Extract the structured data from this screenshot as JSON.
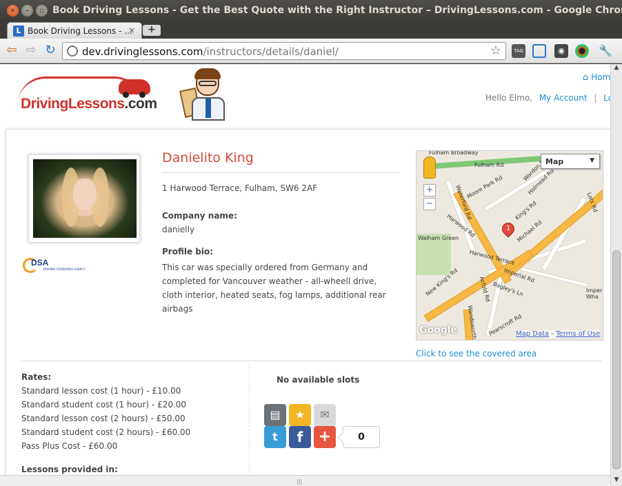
{
  "window": {
    "title": "Book Driving Lessons - Get the Best Quote with the Right Instructor – DrivingLessons.com - Google Chrome"
  },
  "tab": {
    "label": "Book Driving Lessons - …",
    "favicon": "L"
  },
  "toolbar": {
    "url_host": "dev.drivinglessons.com",
    "url_path": "/instructors/details/daniel/",
    "back_icon": "back-arrow-icon",
    "forward_icon": "forward-arrow-icon",
    "reload_icon": "reload-icon",
    "tag_label": "TAG"
  },
  "header": {
    "logo_main": "DrivingLessons",
    "logo_tld": ".com",
    "home_link": "Hom",
    "greeting": "Hello Elmo,",
    "account_link": "My Account",
    "logout_link": "Logo"
  },
  "instructor": {
    "name": "Danielito King",
    "address": "1 Harwood Terrace, Fulham, SW6 2AF",
    "company_label": "Company name:",
    "company_value": "danielly",
    "bio_label": "Profile bio:",
    "bio": "This car was specially ordered from Germany and completed for Vancouver weather - all-wheell drive, cloth interior, heated seats, fog lamps, additional rear airbags",
    "dsa_text": "DSA",
    "dsa_sub": "DRIVING STANDARDS AGENCY"
  },
  "map": {
    "type_label": "Map",
    "zoom_in": "+",
    "zoom_out": "−",
    "marker_label": "1",
    "roads": {
      "fulham_rd": "Fulham Rd",
      "fulham_broadway": "Fulham Broadway",
      "wardo_rd": "Wardon Rd",
      "holmead_rd": "Holmead Rd",
      "moore_park_rd": "Moore Park Rd",
      "waterford_rd": "Waterford Rd",
      "harwood_rd": "Harwood Rd",
      "kings_rd": "King's Rd",
      "michael_rd": "Michael Rd",
      "lots_rd": "Lots Rd",
      "walham_green": "Walham Green",
      "new_kings_rd": "New King's Rd",
      "harwood_terrace": "Harwood Terrace",
      "imperial_rd": "Imperial Rd",
      "bagleys_ln": "Bagley's Ln",
      "acfold_rd": "Acfold Rd",
      "wandsworth": "Wandsworth",
      "pearscroft_rd": "Pearscroft Rd",
      "imperial_wharf": "Imper Wha"
    },
    "google": "Google",
    "map_data": "Map Data",
    "terms": "Terms of Use",
    "covered_link": "Click to see the covered area"
  },
  "rates": {
    "title": "Rates:",
    "items": [
      "Standard lesson cost (1 hour) - £10.00",
      "Standard student cost (1 hour) - £20.00",
      "Standard lesson cost (2 hours) - £50.00",
      "Standard student cost (2 hours) - £60.00",
      "Pass Plus Cost - £60.00"
    ],
    "lessons_title": "Lessons provided in:"
  },
  "slots": {
    "text": "No available slots"
  },
  "share": {
    "count": "0",
    "colors": {
      "print": "#6d7278",
      "favorite": "#f3b523",
      "email": "#d9d9d9",
      "twitter": "#3a9cd7",
      "facebook": "#3b5a9a",
      "addthis": "#e8553f"
    }
  }
}
